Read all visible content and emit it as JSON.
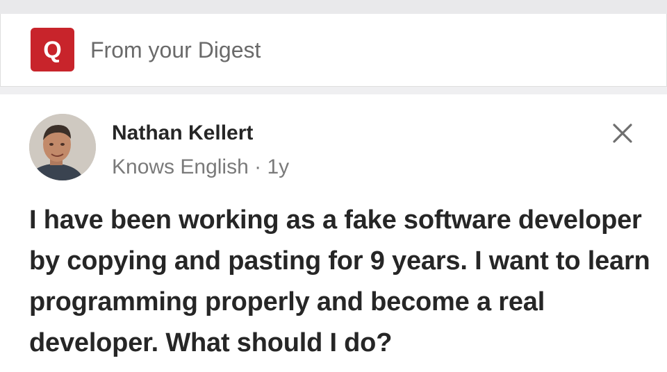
{
  "digest": {
    "logo_letter": "Q",
    "label": "From your Digest",
    "brand_color": "#c8242b"
  },
  "answer": {
    "author_name": "Nathan Kellert",
    "credential": "Knows English",
    "separator": " · ",
    "age": "1y",
    "close_icon": "close-icon"
  },
  "question": {
    "text": "I have been working as a fake software developer by copying and pasting for 9 years. I want to learn programming properly and become a real developer. What should I do?"
  }
}
